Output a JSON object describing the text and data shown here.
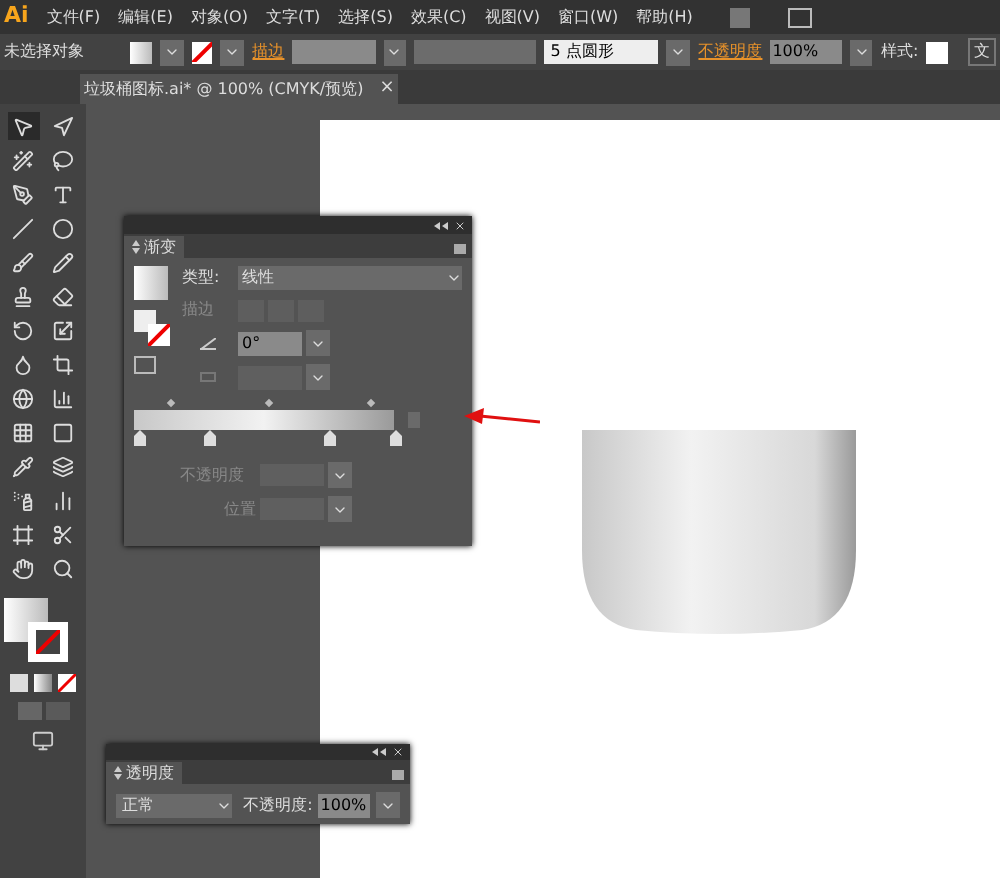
{
  "menu_bar": {
    "logo": "Ai",
    "items": [
      "文件(F)",
      "编辑(E)",
      "对象(O)",
      "文字(T)",
      "选择(S)",
      "效果(C)",
      "视图(V)",
      "窗口(W)",
      "帮助(H)"
    ]
  },
  "control_bar": {
    "selection": "未选择对象",
    "stroke_label": "描边",
    "brush": "5 点圆形",
    "opacity_label": "不透明度",
    "opacity_value": "100%",
    "style_label": "样式:",
    "cut_off": "文"
  },
  "document_tab": {
    "title": "垃圾桶图标.ai* @ 100% (CMYK/预览)",
    "close": "×"
  },
  "gradient_panel": {
    "title": "渐变",
    "type_label": "类型:",
    "type_value": "线性",
    "stroke_label": "描边",
    "angle_value": "0°",
    "opacity_label": "不透明度",
    "position_label": "位置"
  },
  "transparency_panel": {
    "title": "透明度",
    "blend_mode": "正常",
    "opacity_label": "不透明度:",
    "opacity_value": "100%"
  }
}
